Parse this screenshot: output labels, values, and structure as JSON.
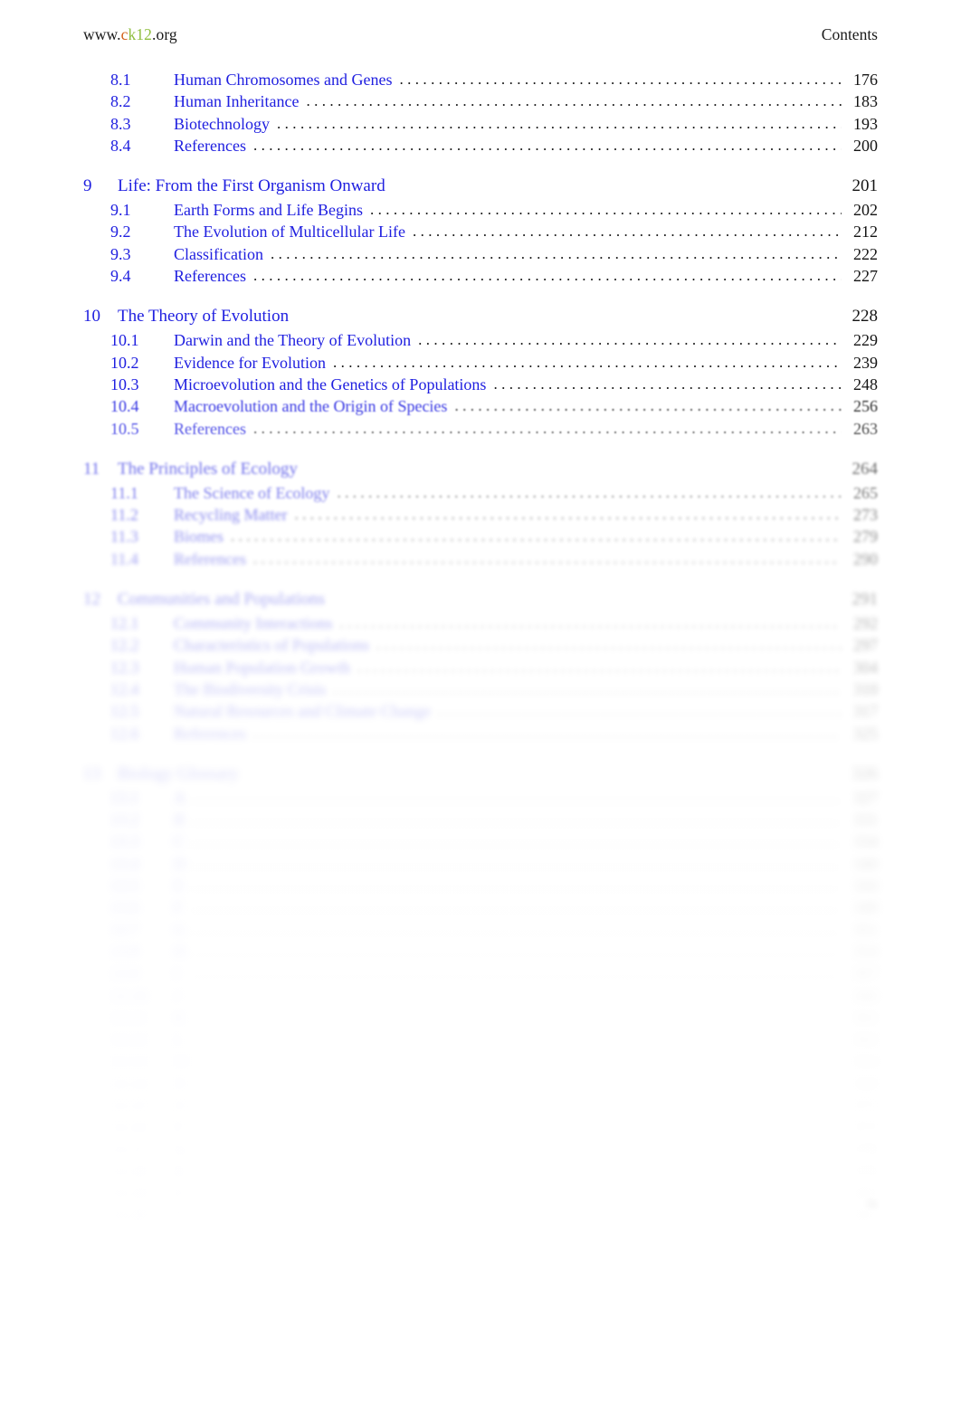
{
  "header": {
    "url_prefix": "www.",
    "url_c": "c",
    "url_k12": "k12",
    "url_suffix": ".org",
    "right_label": "Contents"
  },
  "colors": {
    "link_blue": "#2020e0",
    "page_number_black": "#141414",
    "logo_c_orange": "#d2601a",
    "logo_k12_green": "#8fbe3f",
    "paper_white": "#ffffff"
  },
  "folio": "ix",
  "groups": [
    {
      "spaced": false,
      "rows": [
        {
          "level": "section",
          "num": "8.1",
          "title": "Human Chromosomes and Genes",
          "page": "176"
        },
        {
          "level": "section",
          "num": "8.2",
          "title": "Human Inheritance",
          "page": "183"
        },
        {
          "level": "section",
          "num": "8.3",
          "title": "Biotechnology",
          "page": "193"
        },
        {
          "level": "section",
          "num": "8.4",
          "title": "References",
          "page": "200"
        }
      ]
    },
    {
      "spaced": true,
      "rows": [
        {
          "level": "chapter",
          "num": "9",
          "title": "Life: From the First Organism Onward",
          "page": "201"
        },
        {
          "level": "section",
          "num": "9.1",
          "title": "Earth Forms and Life Begins",
          "page": "202"
        },
        {
          "level": "section",
          "num": "9.2",
          "title": "The Evolution of Multicellular Life",
          "page": "212"
        },
        {
          "level": "section",
          "num": "9.3",
          "title": "Classification",
          "page": "222"
        },
        {
          "level": "section",
          "num": "9.4",
          "title": "References",
          "page": "227"
        }
      ]
    },
    {
      "spaced": true,
      "rows": [
        {
          "level": "chapter",
          "num": "10",
          "title": "The Theory of Evolution",
          "page": "228"
        },
        {
          "level": "section",
          "num": "10.1",
          "title": "Darwin and the Theory of Evolution",
          "page": "229"
        },
        {
          "level": "section",
          "num": "10.2",
          "title": "Evidence for Evolution",
          "page": "239"
        },
        {
          "level": "section",
          "num": "10.3",
          "title": "Microevolution and the Genetics of Populations",
          "page": "248"
        },
        {
          "level": "section",
          "num": "10.4",
          "title": "Macroevolution and the Origin of Species",
          "page": "256"
        },
        {
          "level": "section",
          "num": "10.5",
          "title": "References",
          "page": "263"
        }
      ]
    },
    {
      "spaced": true,
      "rows": [
        {
          "level": "chapter",
          "num": "11",
          "title": "The Principles of Ecology",
          "page": "264"
        },
        {
          "level": "section",
          "num": "11.1",
          "title": "The Science of Ecology",
          "page": "265"
        },
        {
          "level": "section",
          "num": "11.2",
          "title": "Recycling Matter",
          "page": "273"
        },
        {
          "level": "section",
          "num": "11.3",
          "title": "Biomes",
          "page": "279"
        },
        {
          "level": "section",
          "num": "11.4",
          "title": "References",
          "page": "290"
        }
      ]
    },
    {
      "spaced": true,
      "rows": [
        {
          "level": "chapter",
          "num": "12",
          "title": "Communities and Populations",
          "page": "291"
        },
        {
          "level": "section",
          "num": "12.1",
          "title": "Community Interactions",
          "page": "292"
        },
        {
          "level": "section",
          "num": "12.2",
          "title": "Characteristics of Populations",
          "page": "297"
        },
        {
          "level": "section",
          "num": "12.3",
          "title": "Human Population Growth",
          "page": "304"
        },
        {
          "level": "section",
          "num": "12.4",
          "title": "The Biodiversity Crisis",
          "page": "310"
        },
        {
          "level": "section",
          "num": "12.5",
          "title": "Natural Resources and Climate Change",
          "page": "317"
        },
        {
          "level": "section",
          "num": "12.6",
          "title": "References",
          "page": "325"
        }
      ]
    },
    {
      "spaced": true,
      "rows": [
        {
          "level": "chapter",
          "num": "13",
          "title": "Biology Glossary",
          "page": "326"
        },
        {
          "level": "glossary",
          "num": "13.1",
          "title": "A",
          "page": "327"
        },
        {
          "level": "glossary",
          "num": "13.2",
          "title": "B",
          "page": "331"
        },
        {
          "level": "glossary",
          "num": "13.3",
          "title": "C",
          "page": "334"
        },
        {
          "level": "glossary",
          "num": "13.4",
          "title": "D",
          "page": "340"
        },
        {
          "level": "glossary",
          "num": "13.5",
          "title": "E",
          "page": "344"
        },
        {
          "level": "glossary",
          "num": "13.6",
          "title": "F",
          "page": "348"
        },
        {
          "level": "glossary",
          "num": "13.7",
          "title": "G",
          "page": "351"
        },
        {
          "level": "glossary",
          "num": "13.8",
          "title": "H",
          "page": "354"
        },
        {
          "level": "glossary",
          "num": "13.9",
          "title": "I",
          "page": "357"
        },
        {
          "level": "glossary",
          "num": "13.10",
          "title": "J",
          "page": "360"
        },
        {
          "level": "glossary",
          "num": "13.11",
          "title": "K",
          "page": "361"
        },
        {
          "level": "glossary",
          "num": "13.12",
          "title": "L",
          "page": "362"
        },
        {
          "level": "glossary",
          "num": "13.13",
          "title": "M",
          "page": "364"
        },
        {
          "level": "glossary",
          "num": "13.14",
          "title": "N",
          "page": "368"
        },
        {
          "level": "glossary",
          "num": "13.15",
          "title": "O",
          "page": "371"
        },
        {
          "level": "glossary",
          "num": "13.16",
          "title": "P",
          "page": "373"
        },
        {
          "level": "glossary",
          "num": "13.17",
          "title": "Q",
          "page": "378"
        },
        {
          "level": "glossary",
          "num": "13.18",
          "title": "R",
          "page": "379"
        },
        {
          "level": "glossary",
          "num": "13.19",
          "title": "S",
          "page": "382"
        },
        {
          "level": "glossary",
          "num": "13.20",
          "title": "T",
          "page": "387"
        }
      ]
    }
  ]
}
